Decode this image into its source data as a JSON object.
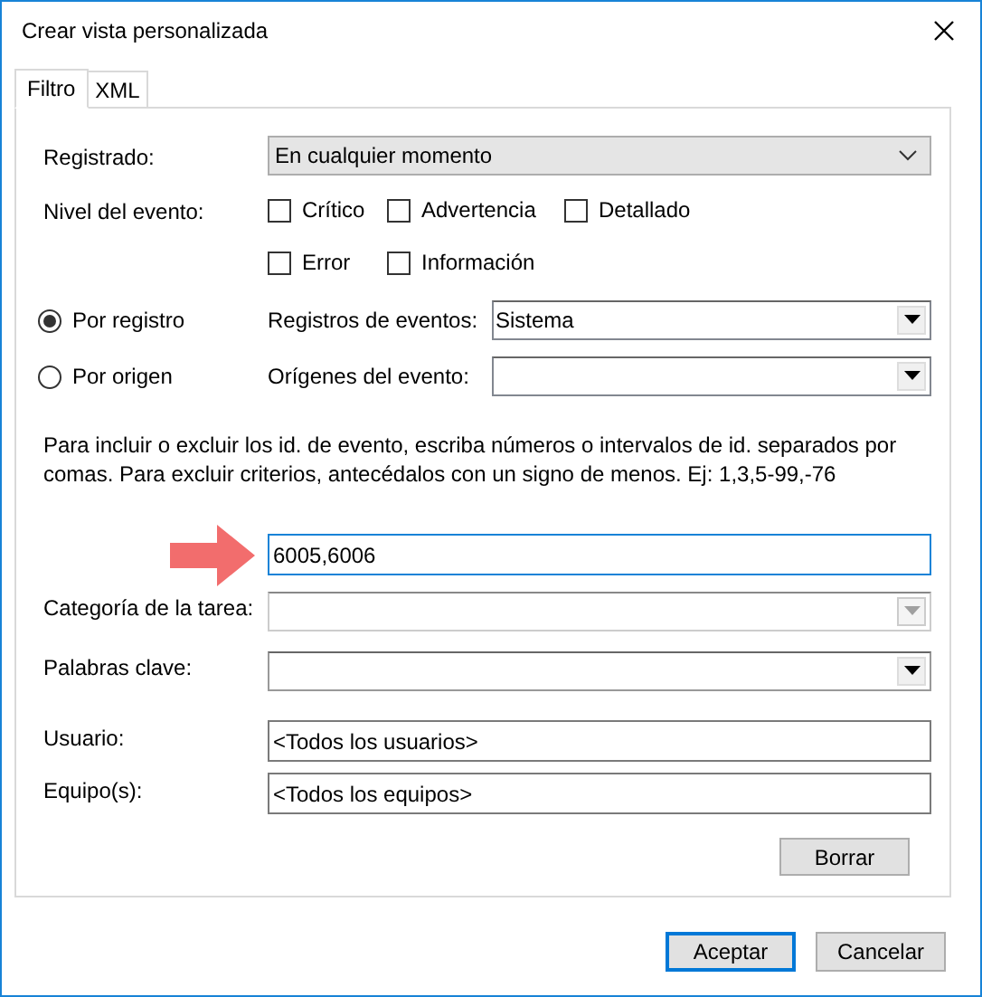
{
  "window": {
    "title": "Crear vista personalizada"
  },
  "tabs": [
    {
      "label": "Filtro",
      "selected": true
    },
    {
      "label": "XML",
      "selected": false
    }
  ],
  "logged": {
    "label": "Registrado:",
    "value": "En cualquier momento"
  },
  "event_level": {
    "label": "Nivel del evento:",
    "rows": [
      [
        {
          "label": "Crítico",
          "checked": false
        },
        {
          "label": "Advertencia",
          "checked": false
        },
        {
          "label": "Detallado",
          "checked": false
        }
      ],
      [
        {
          "label": "Error",
          "checked": false
        },
        {
          "label": "Información",
          "checked": false
        }
      ]
    ]
  },
  "source_mode": [
    {
      "label": "Por registro",
      "selected": true,
      "field_label": "Registros de eventos:",
      "value": "Sistema"
    },
    {
      "label": "Por origen",
      "selected": false,
      "field_label": "Orígenes del evento:"
    }
  ],
  "instructions": "Para incluir o excluir los id. de evento, escriba números o intervalos de id. separados por comas. Para excluir criterios, antecédalos con un signo de menos. Ej: 1,3,5-99,-76",
  "event_ids": {
    "value": "6005,6006",
    "focused": true
  },
  "task_category": {
    "label": "Categoría de la tarea:",
    "disabled": true
  },
  "keywords": {
    "label": "Palabras clave:",
    "disabled": false
  },
  "user": {
    "label": "Usuario:",
    "value": "<Todos los usuarios>"
  },
  "computer": {
    "label": "Equipo(s):",
    "value": "<Todos los equipos>"
  },
  "clear_button": {
    "label": "Borrar"
  },
  "buttons": [
    {
      "label": "Aceptar",
      "default": true
    },
    {
      "label": "Cancelar",
      "default": false
    }
  ]
}
